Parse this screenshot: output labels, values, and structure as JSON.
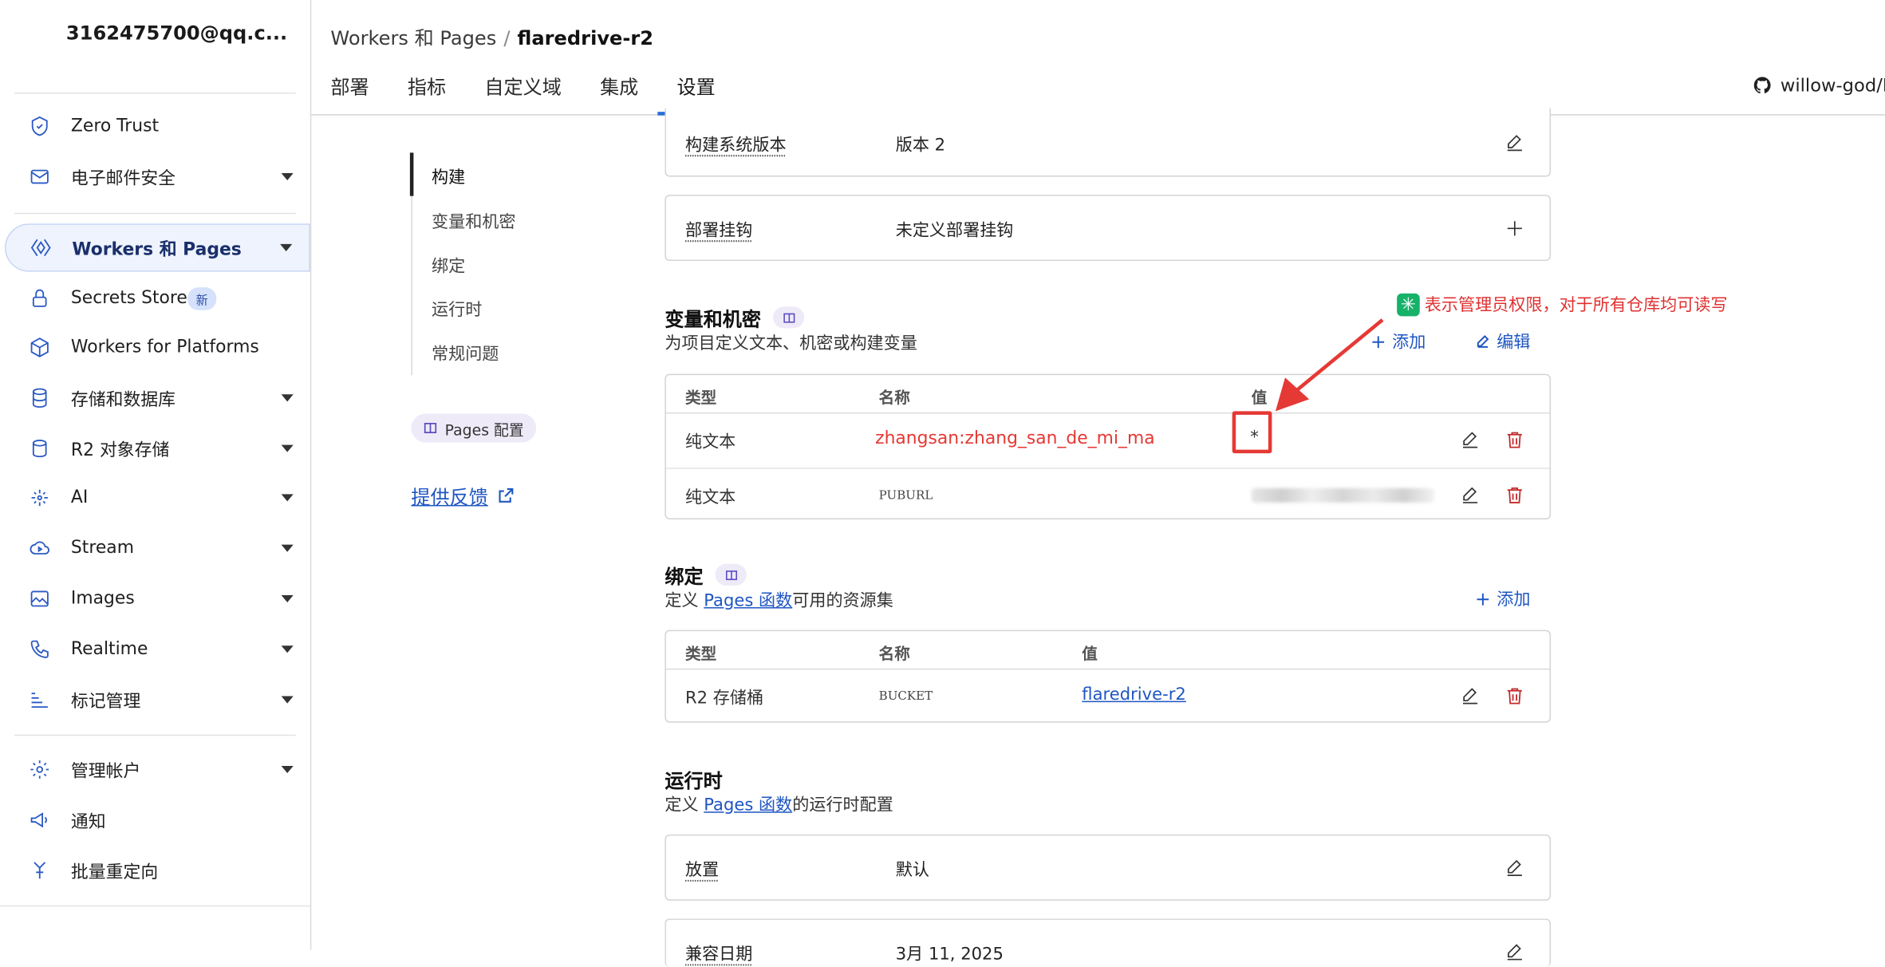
{
  "sidebar": {
    "account": "3162475700@qq.c...",
    "items": [
      {
        "label": "Zero Trust",
        "icon": "zero-trust-icon",
        "caret": false
      },
      {
        "label": "电子邮件安全",
        "icon": "mail-icon",
        "caret": true
      },
      {
        "label": "Workers 和 Pages",
        "icon": "workers-icon",
        "caret": true,
        "active": true
      },
      {
        "label": "Secrets Store",
        "icon": "lock-icon",
        "caret": false,
        "badge": "新"
      },
      {
        "label": "Workers for Platforms",
        "icon": "cube-icon",
        "caret": false
      },
      {
        "label": "存储和数据库",
        "icon": "database-icon",
        "caret": true
      },
      {
        "label": "R2 对象存储",
        "icon": "storage-icon",
        "caret": true
      },
      {
        "label": "AI",
        "icon": "ai-sparkle-icon",
        "caret": true
      },
      {
        "label": "Stream",
        "icon": "stream-cloud-icon",
        "caret": true
      },
      {
        "label": "Images",
        "icon": "image-icon",
        "caret": true
      },
      {
        "label": "Realtime",
        "icon": "phone-icon",
        "caret": true
      },
      {
        "label": "标记管理",
        "icon": "tag-list-icon",
        "caret": true
      },
      {
        "label": "管理帐户",
        "icon": "gear-icon",
        "caret": true
      },
      {
        "label": "通知",
        "icon": "megaphone-icon",
        "caret": false
      },
      {
        "label": "批量重定向",
        "icon": "redirect-icon",
        "caret": false
      }
    ]
  },
  "header": {
    "breadcrumb_parent": "Workers 和 Pages",
    "breadcrumb_sep": "/",
    "breadcrumb_current": "flaredrive-r2",
    "tabs": [
      "部署",
      "指标",
      "自定义域",
      "集成",
      "设置"
    ],
    "active_tab": "设置",
    "repo": "willow-god/F"
  },
  "subnav": {
    "items": [
      "构建",
      "变量和机密",
      "绑定",
      "运行时",
      "常规问题"
    ],
    "active": "构建",
    "pages_config": "Pages 配置",
    "feedback": "提供反馈"
  },
  "build": {
    "version_label": "构建系统版本",
    "version_value": "版本 2",
    "hook_label": "部署挂钩",
    "hook_value": "未定义部署挂钩"
  },
  "variables": {
    "title": "变量和机密",
    "desc": "为项目定义文本、机密或构建变量",
    "add": "添加",
    "edit": "编辑",
    "headers": [
      "类型",
      "名称",
      "值"
    ],
    "rows": [
      {
        "type": "纯文本",
        "name": "zhangsan:zhang_san_de_mi_ma",
        "value": "*"
      },
      {
        "type": "纯文本",
        "name": "PUBURL",
        "value": ""
      }
    ]
  },
  "annotation": {
    "badge": "✳",
    "text": "表示管理员权限，对于所有仓库均可读写",
    "color": "#e53935"
  },
  "bindings": {
    "title": "绑定",
    "desc_pre": "定义 ",
    "desc_link": "Pages 函数",
    "desc_post": "可用的资源集",
    "add": "添加",
    "headers": [
      "类型",
      "名称",
      "值"
    ],
    "rows": [
      {
        "type": "R2 存储桶",
        "name": "BUCKET",
        "value": "flaredrive-r2"
      }
    ]
  },
  "runtime": {
    "title": "运行时",
    "desc_pre": "定义 ",
    "desc_link": "Pages 函数",
    "desc_post": "的运行时配置",
    "placement_label": "放置",
    "placement_value": "默认",
    "compat_label": "兼容日期",
    "compat_value": "3月 11, 2025"
  },
  "colors": {
    "accent": "#2b6fd9",
    "link": "#1f56c2",
    "danger": "#c42b2b"
  }
}
